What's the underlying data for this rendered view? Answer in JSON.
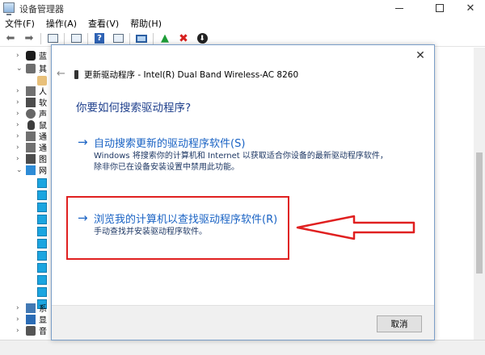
{
  "window": {
    "title": "设备管理器",
    "menu": [
      "文件(F)",
      "操作(A)",
      "查看(V)",
      "帮助(H)"
    ]
  },
  "tree": {
    "items": [
      {
        "label": "蓝",
        "icon": "bluetooth-icon",
        "expanded": false
      },
      {
        "label": "其",
        "icon": "keyboard-icon",
        "expanded": true
      },
      {
        "label": "",
        "icon": "unknown-device-icon",
        "expanded": null
      },
      {
        "label": "人",
        "icon": "hid-icon",
        "expanded": false
      },
      {
        "label": "软",
        "icon": "software-device-icon",
        "expanded": false
      },
      {
        "label": "声",
        "icon": "sound-icon",
        "expanded": false
      },
      {
        "label": "鼠",
        "icon": "mouse-icon",
        "expanded": false
      },
      {
        "label": "通",
        "icon": "usb-controller-icon",
        "expanded": false
      },
      {
        "label": "通",
        "icon": "usb-device-icon",
        "expanded": false
      },
      {
        "label": "图",
        "icon": "imaging-icon",
        "expanded": false
      },
      {
        "label": "网",
        "icon": "network-adapter-icon",
        "expanded": true
      },
      {
        "label": "系",
        "icon": "system-device-icon",
        "expanded": false
      },
      {
        "label": "显",
        "icon": "display-adapter-icon",
        "expanded": false
      },
      {
        "label": "音",
        "icon": "audio-io-icon",
        "expanded": false
      }
    ],
    "network_children_count": 11
  },
  "dialog": {
    "title": "更新驱动程序 - Intel(R) Dual Band Wireless-AC 8260",
    "heading": "你要如何搜索驱动程序?",
    "option_auto": {
      "label": "自动搜索更新的驱动程序软件(S)",
      "desc1": "Windows 将搜索你的计算机和 Internet 以获取适合你设备的最新驱动程序软件，",
      "desc2": "除非你已在设备安装设置中禁用此功能。"
    },
    "option_browse": {
      "label": "浏览我的计算机以查找驱动程序软件(R)",
      "desc": "手动查找并安装驱动程序软件。"
    },
    "cancel_label": "取消"
  },
  "annotation": {
    "color": "#e02020"
  }
}
